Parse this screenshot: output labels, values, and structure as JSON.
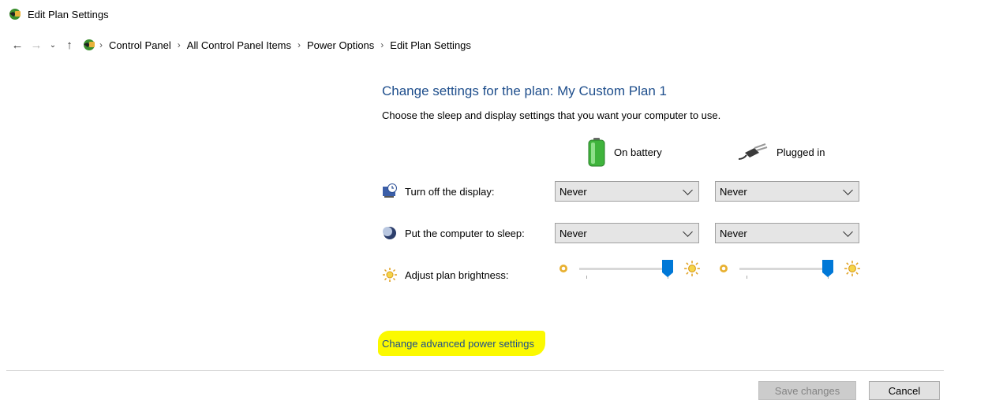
{
  "window": {
    "title": "Edit Plan Settings"
  },
  "nav": {
    "breadcrumbs": [
      "Control Panel",
      "All Control Panel Items",
      "Power Options",
      "Edit Plan Settings"
    ]
  },
  "main": {
    "heading": "Change settings for the plan: My Custom Plan 1",
    "subheading": "Choose the sleep and display settings that you want your computer to use.",
    "columns": {
      "battery": "On battery",
      "plugged": "Plugged in"
    },
    "rows": {
      "display": {
        "label": "Turn off the display:",
        "battery": "Never",
        "plugged": "Never"
      },
      "sleep": {
        "label": "Put the computer to sleep:",
        "battery": "Never",
        "plugged": "Never"
      },
      "brightness": {
        "label": "Adjust plan brightness:",
        "battery_percent": 100,
        "plugged_percent": 100
      }
    },
    "advanced_link": "Change advanced power settings"
  },
  "footer": {
    "save_label": "Save changes",
    "cancel_label": "Cancel"
  },
  "colors": {
    "heading": "#1e4e8c",
    "highlight": "#fbf900",
    "accent": "#0078d7"
  }
}
